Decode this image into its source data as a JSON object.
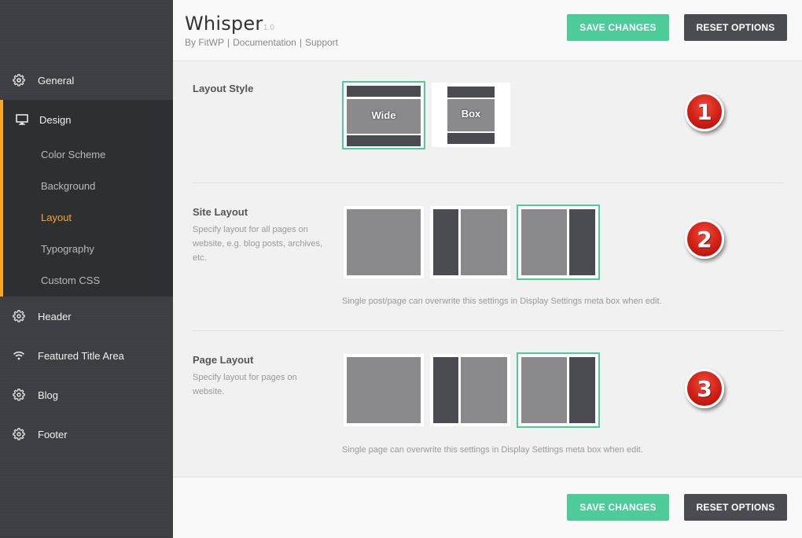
{
  "sidebar": {
    "items": [
      {
        "label": "General",
        "icon": "gear-icon"
      },
      {
        "label": "Design",
        "icon": "monitor-icon"
      },
      {
        "label": "Header",
        "icon": "gear-icon"
      },
      {
        "label": "Featured Title Area",
        "icon": "wifi-icon"
      },
      {
        "label": "Blog",
        "icon": "gear-icon"
      },
      {
        "label": "Footer",
        "icon": "gear-icon"
      }
    ],
    "design_sub_items": [
      {
        "label": "Color Scheme",
        "active": false
      },
      {
        "label": "Background",
        "active": false
      },
      {
        "label": "Layout",
        "active": true
      },
      {
        "label": "Typography",
        "active": false
      },
      {
        "label": "Custom CSS",
        "active": false
      }
    ]
  },
  "header": {
    "title": "Whisper",
    "version": "1.0",
    "by": "By FitWP",
    "links": [
      "Documentation",
      "Support"
    ],
    "separator": "|",
    "save_label": "SAVE CHANGES",
    "reset_label": "RESET OPTIONS"
  },
  "sections": {
    "layout_style": {
      "label": "Layout Style",
      "options": [
        {
          "label": "Wide",
          "selected": true
        },
        {
          "label": "Box",
          "selected": false
        }
      ],
      "badge": "1"
    },
    "site_layout": {
      "label": "Site Layout",
      "description": "Specify layout for all pages on website, e.g. blog posts, archives, etc.",
      "note": "Single post/page can overwrite this settings in Display Settings meta box when edit.",
      "selected_index": 2,
      "badge": "2"
    },
    "page_layout": {
      "label": "Page Layout",
      "description": "Specify layout for pages on website.",
      "note": "Single page can overwrite this settings in Display Settings meta box when edit.",
      "selected_index": 2,
      "badge": "3"
    }
  },
  "footer": {
    "save_label": "SAVE CHANGES",
    "reset_label": "RESET OPTIONS"
  },
  "colors": {
    "accent": "#4dcb99",
    "active_nav": "#f5a623",
    "sidebar_bg": "#3d3e43",
    "badge_red": "#d11f16"
  }
}
